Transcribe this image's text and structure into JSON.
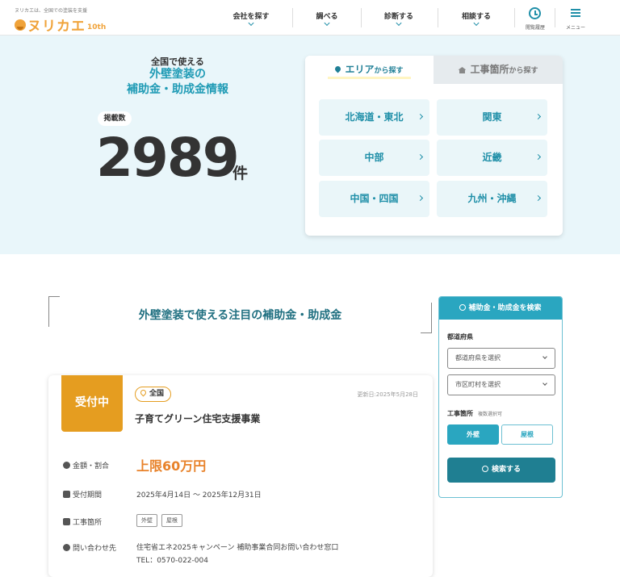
{
  "header": {
    "tagline": "ヌリカエは、全国での塗装を支援",
    "logo_text": "ヌリカエ",
    "logo_suffix": "10th",
    "nav": [
      {
        "label": "会社を探す"
      },
      {
        "label": "調べる"
      },
      {
        "label": "診断する"
      },
      {
        "label": "相談する"
      }
    ],
    "history_label": "閲覧履歴",
    "menu_label": "メニュー"
  },
  "hero": {
    "subtitle": "全国で使える",
    "title_line1": "外壁塗装の",
    "title_line2": "補助金・助成金情報",
    "badge": "掲載数",
    "count": "2989",
    "unit": "件",
    "tabs": {
      "area_main": "エリア",
      "area_small": "から探す",
      "work_main": "工事箇所",
      "work_small": "から探す"
    },
    "regions": [
      "北海道・東北",
      "関東",
      "中部",
      "近畿",
      "中国・四国",
      "九州・沖縄"
    ]
  },
  "main": {
    "section_title": "外壁塗装で使える注目の補助金・助成金",
    "card": {
      "status": "受付中",
      "scope": "全国",
      "updated": "更新日:2025年5月28日",
      "title": "子育てグリーン住宅支援事業",
      "amount_label": "金額・割合",
      "amount": "上限60万円",
      "period_label": "受付期間",
      "period": "2025年4月14日 ～ 2025年12月31日",
      "work_label": "工事箇所",
      "work_tags": [
        "外壁",
        "屋根"
      ],
      "contact_label": "問い合わせ先",
      "contact_name": "住宅省エネ2025キャンペーン 補助事業合同お問い合わせ窓口",
      "contact_tel": "TEL：0570-022-004"
    }
  },
  "sidebar": {
    "title": "補助金・助成金を検索",
    "pref_label": "都道府県",
    "pref_placeholder": "都道府県を選択",
    "city_placeholder": "市区町村を選択",
    "work_label": "工事箇所",
    "work_note": "複数選択可",
    "opt_wall": "外壁",
    "opt_roof": "屋根",
    "submit": "検索する"
  },
  "colors": {
    "accent": "#2aa6c0",
    "brand_orange": "#f0a33a",
    "status_orange": "#e59d20",
    "hero_bg": "#e9f6fa"
  }
}
